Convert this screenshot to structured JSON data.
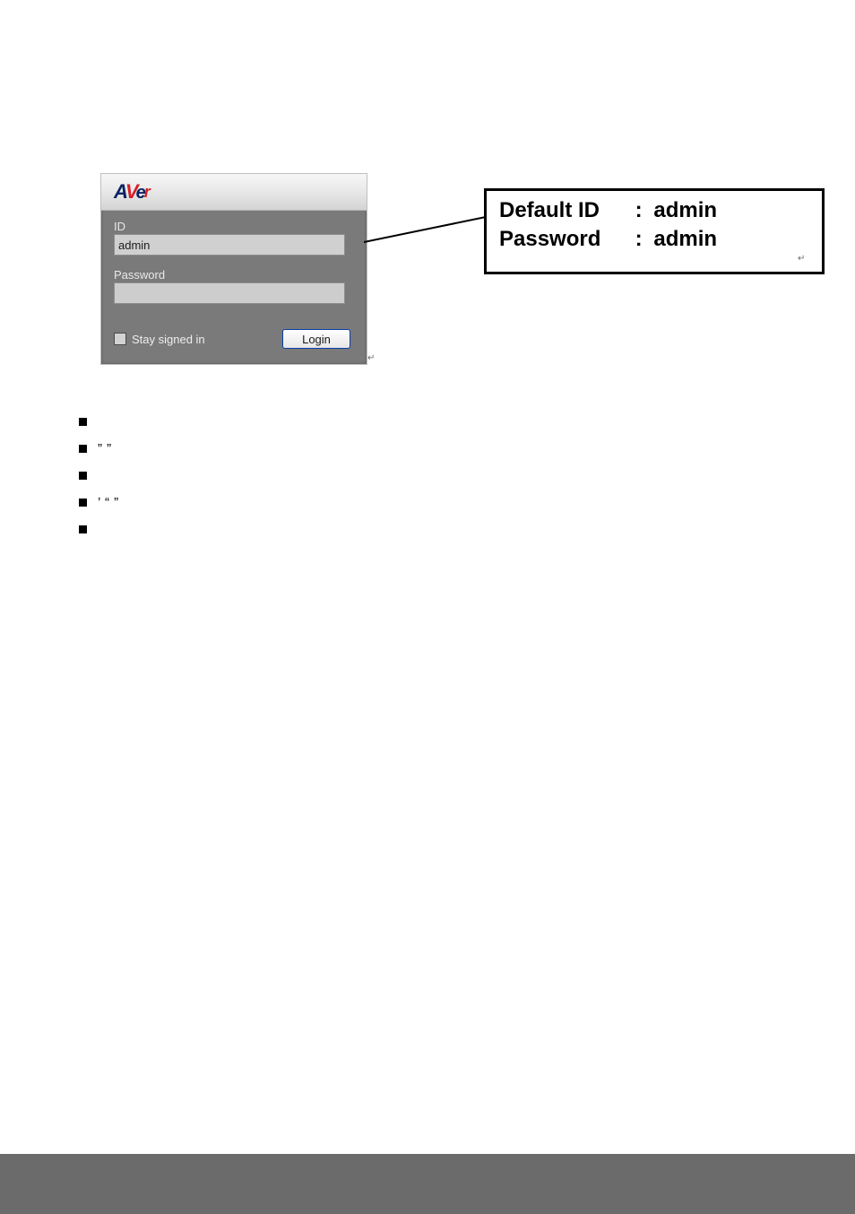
{
  "login": {
    "id_label": "ID",
    "id_value": "admin",
    "password_label": "Password",
    "password_value": "",
    "stay_label": "Stay signed in",
    "login_button": "Login"
  },
  "callout": {
    "row1_label": "Default ID",
    "row1_value": "admin",
    "row2_label": "Password",
    "row2_value": "admin"
  },
  "bullets": {
    "items": [
      "",
      "”       ”",
      "",
      "’    “ ”",
      ""
    ]
  }
}
